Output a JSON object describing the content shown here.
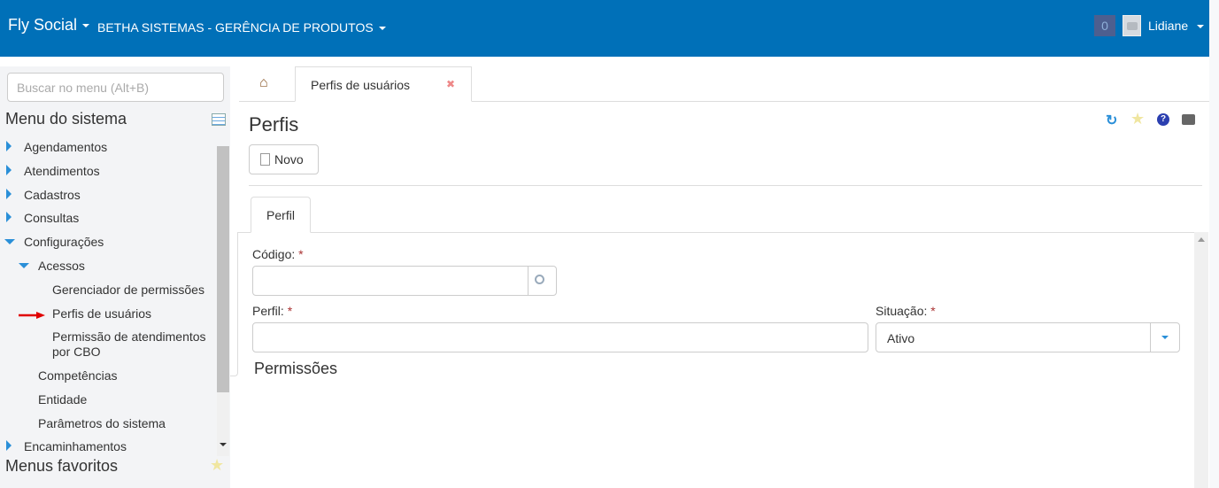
{
  "header": {
    "brand": "Fly Social",
    "org": "BETHA SISTEMAS - GERÊNCIA DE PRODUTOS",
    "notifications": "0",
    "user": "Lidiane"
  },
  "sidebar": {
    "search_placeholder": "Buscar no menu (Alt+B)",
    "title": "Menu do sistema",
    "items": [
      {
        "label": "Agendamentos",
        "state": "collapsed"
      },
      {
        "label": "Atendimentos",
        "state": "collapsed"
      },
      {
        "label": "Cadastros",
        "state": "collapsed"
      },
      {
        "label": "Consultas",
        "state": "collapsed"
      },
      {
        "label": "Configurações",
        "state": "expanded"
      },
      {
        "label": "Acessos",
        "state": "expanded"
      },
      {
        "label": "Gerenciador de permissões"
      },
      {
        "label": "Perfis de usuários",
        "marked": true
      },
      {
        "label": "Permissão de atendimentos por CBO"
      },
      {
        "label": "Competências"
      },
      {
        "label": "Entidade"
      },
      {
        "label": "Parâmetros do sistema"
      },
      {
        "label": "Encaminhamentos",
        "state": "collapsed"
      }
    ],
    "favorites_title": "Menus favoritos"
  },
  "tabs": [
    {
      "label": "Perfis de usuários",
      "active": true
    }
  ],
  "page": {
    "title": "Perfis",
    "new_button": "Novo",
    "subtab": "Perfil",
    "fields": {
      "codigo_label": "Código:",
      "perfil_label": "Perfil:",
      "situacao_label": "Situação:",
      "required": "*",
      "situacao_value": "Ativo",
      "codigo_value": "",
      "perfil_value": ""
    },
    "section": "Permissões"
  },
  "colors": {
    "header": "#0070b8",
    "accent": "#2a8fd8",
    "arrow": "#e00000"
  }
}
